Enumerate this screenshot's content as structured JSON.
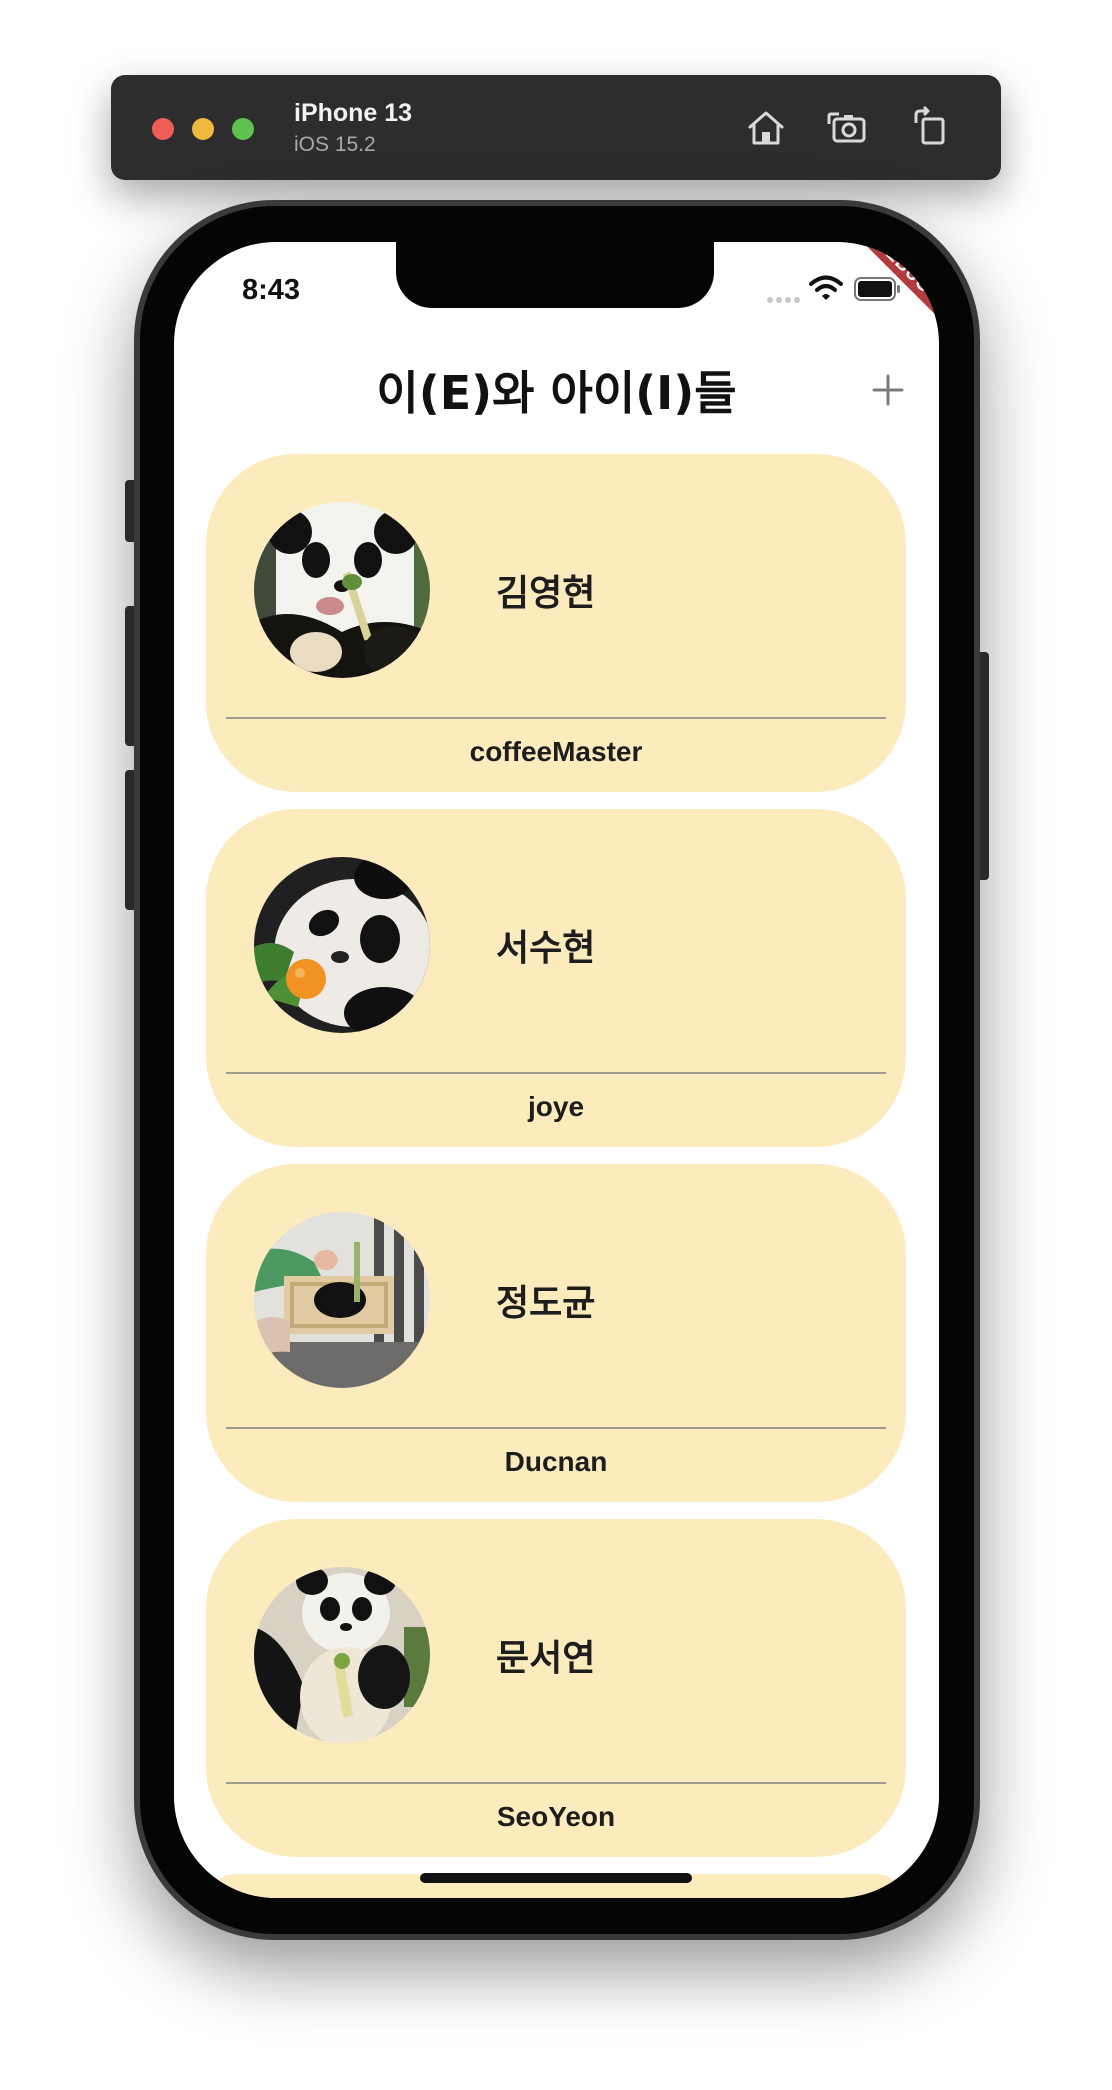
{
  "simulator": {
    "device_name": "iPhone 13",
    "os_version": "iOS 15.2",
    "toolbar": [
      {
        "name": "home-button",
        "icon": "home-icon"
      },
      {
        "name": "screenshot-button",
        "icon": "camera-icon"
      },
      {
        "name": "rotate-button",
        "icon": "rotate-icon"
      }
    ]
  },
  "status_bar": {
    "time": "8:43",
    "debug_banner": "DEBUG"
  },
  "app": {
    "title": "이(E)와 아이(I)들",
    "add_icon": "plus-icon"
  },
  "members": [
    {
      "name": "김영현",
      "nickname": "coffeeMaster",
      "avatar": "panda-eating-bamboo"
    },
    {
      "name": "서수현",
      "nickname": "joye",
      "avatar": "panda-with-orange"
    },
    {
      "name": "정도균",
      "nickname": "Ducnan",
      "avatar": "panda-feeder-box"
    },
    {
      "name": "문서연",
      "nickname": "SeoYeon",
      "avatar": "panda-sitting"
    }
  ],
  "colors": {
    "card_background": "#fbebbd",
    "debug_ribbon": "#b23b3f",
    "sim_bar": "#2d2d2e"
  }
}
